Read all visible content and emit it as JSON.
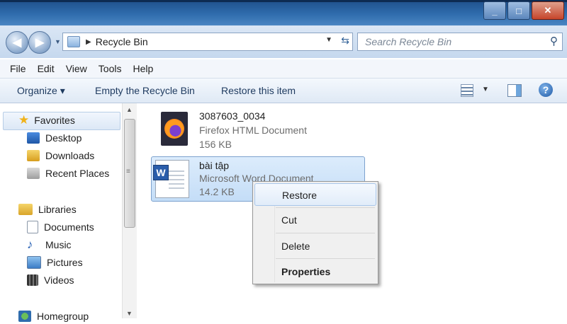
{
  "window": {
    "controls": {
      "minimize": "_",
      "maximize": "□",
      "close": "✕"
    }
  },
  "nav": {
    "back_icon": "back-arrow-icon",
    "forward_icon": "forward-arrow-icon",
    "address": "Recycle Bin",
    "search_placeholder": "Search Recycle Bin"
  },
  "menubar": [
    "File",
    "Edit",
    "View",
    "Tools",
    "Help"
  ],
  "toolbar": {
    "organize": "Organize ▾",
    "empty_bin": "Empty the Recycle Bin",
    "restore_item": "Restore this item"
  },
  "sidebar": {
    "favorites_header": "Favorites",
    "favorites": [
      "Desktop",
      "Downloads",
      "Recent Places"
    ],
    "libraries_header": "Libraries",
    "libraries": [
      "Documents",
      "Music",
      "Pictures",
      "Videos"
    ],
    "homegroup": "Homegroup"
  },
  "files": [
    {
      "name": "3087603_0034",
      "type": "Firefox HTML Document",
      "size": "156 KB",
      "icon": "firefox-icon"
    },
    {
      "name": "bài tập",
      "type": "Microsoft Word Document",
      "size": "14.2 KB",
      "icon": "word-document-icon",
      "selected": true
    }
  ],
  "context_menu": {
    "items": [
      "Restore",
      "Cut",
      "Delete",
      "Properties"
    ],
    "highlighted": "Restore",
    "bold": "Properties"
  },
  "colors": {
    "titlebar": "#2f6cad",
    "selection": "#cde3fa",
    "close_button": "#c6452b"
  }
}
